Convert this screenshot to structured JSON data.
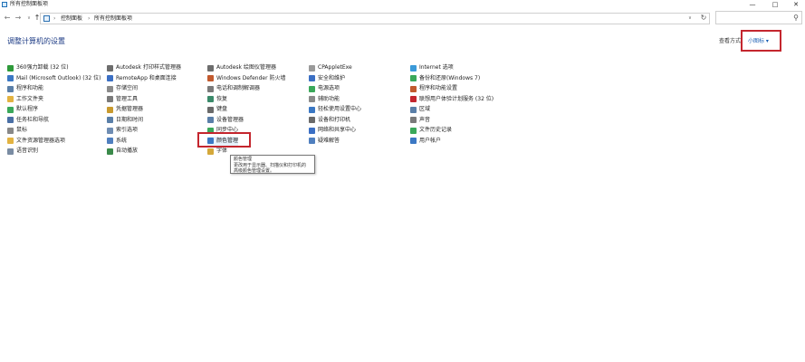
{
  "window": {
    "title": "所有控制面板项",
    "minimize_glyph": "—",
    "maximize_glyph": "□",
    "close_glyph": "✕"
  },
  "nav": {
    "back_glyph": "←",
    "forward_glyph": "→",
    "recent_glyph": "∨",
    "up_glyph": "↑",
    "crumb_sep": "›",
    "breadcrumb": [
      "控制面板",
      "所有控制面板项"
    ],
    "address_dropdown_glyph": "∨",
    "refresh_glyph": "↻",
    "search_placeholder": "",
    "search_glyph": "⚲"
  },
  "page": {
    "heading": "调整计算机的设置",
    "view_by_label": "查看方式:",
    "view_by_value": "小图标 ▾"
  },
  "columns": [
    [
      {
        "label": "360强力卸载 (32 位)",
        "color": "#2e9a3a"
      },
      {
        "label": "Mail (Microsoft Outlook) (32 位)",
        "color": "#3b78c4"
      },
      {
        "label": "程序和功能",
        "color": "#5a7fa8"
      },
      {
        "label": "工作文件夹",
        "color": "#e3b341"
      },
      {
        "label": "默认程序",
        "color": "#3aa85a"
      },
      {
        "label": "任务栏和导航",
        "color": "#4a6fa5"
      },
      {
        "label": "鼠标",
        "color": "#888888"
      },
      {
        "label": "文件资源管理器选项",
        "color": "#e3b341"
      },
      {
        "label": "语音识别",
        "color": "#7a8ca3"
      }
    ],
    [
      {
        "label": "Autodesk 打印样式管理器",
        "color": "#6d6d6d"
      },
      {
        "label": "RemoteApp 和桌面连接",
        "color": "#3b6fc4"
      },
      {
        "label": "存储空间",
        "color": "#8a8a8a"
      },
      {
        "label": "管理工具",
        "color": "#7a7a7a"
      },
      {
        "label": "凭据管理器",
        "color": "#c99a2e"
      },
      {
        "label": "日期和时间",
        "color": "#5a7fa8"
      },
      {
        "label": "索引选项",
        "color": "#6f8db3"
      },
      {
        "label": "系统",
        "color": "#4f7fbf"
      },
      {
        "label": "自动播放",
        "color": "#3a8a4a"
      }
    ],
    [
      {
        "label": "Autodesk 绘图仪管理器",
        "color": "#6d6d6d"
      },
      {
        "label": "Windows Defender 防火墙",
        "color": "#c25a2e"
      },
      {
        "label": "电话和调制解调器",
        "color": "#7a7a7a"
      },
      {
        "label": "恢复",
        "color": "#3a8a6a"
      },
      {
        "label": "键盘",
        "color": "#6a6a6a"
      },
      {
        "label": "设备管理器",
        "color": "#5a7fa8"
      },
      {
        "label": "同步中心",
        "color": "#3aa85a"
      },
      {
        "label": "颜色管理",
        "color": "#3b78c4"
      },
      {
        "label": "字体",
        "color": "#d4a83a"
      }
    ],
    [
      {
        "label": "CPAppletExe",
        "color": "#9a9a9a"
      },
      {
        "label": "安全和维护",
        "color": "#3b6fc4"
      },
      {
        "label": "电源选项",
        "color": "#3aa85a"
      },
      {
        "label": "辅助功能",
        "color": "#8a8a8a"
      },
      {
        "label": "轻松使用设置中心",
        "color": "#3b78c4"
      },
      {
        "label": "设备和打印机",
        "color": "#6a6a6a"
      },
      {
        "label": "网络和共享中心",
        "color": "#3b6fc4"
      },
      {
        "label": "疑难解答",
        "color": "#4f7fbf"
      }
    ],
    [
      {
        "label": "Internet 选项",
        "color": "#3b9ad9"
      },
      {
        "label": "备份和还原(Windows 7)",
        "color": "#3aa85a"
      },
      {
        "label": "程序和功能设置",
        "color": "#c25a2e"
      },
      {
        "label": "联想用户体验计划服务 (32 位)",
        "color": "#c4262e"
      },
      {
        "label": "区域",
        "color": "#5a7fa8"
      },
      {
        "label": "声音",
        "color": "#7a7a7a"
      },
      {
        "label": "文件历史记录",
        "color": "#3aa85a"
      },
      {
        "label": "用户帐户",
        "color": "#3b78c4"
      }
    ]
  ],
  "tooltip": {
    "lines": [
      "颜色管理",
      "更改用于显示器、扫描仪和打印机的",
      "高级颜色管理设置。"
    ]
  },
  "accent": {
    "highlight_red": "#c4262e",
    "link_blue": "#1a5fb4",
    "heading_blue": "#1b3a84"
  }
}
